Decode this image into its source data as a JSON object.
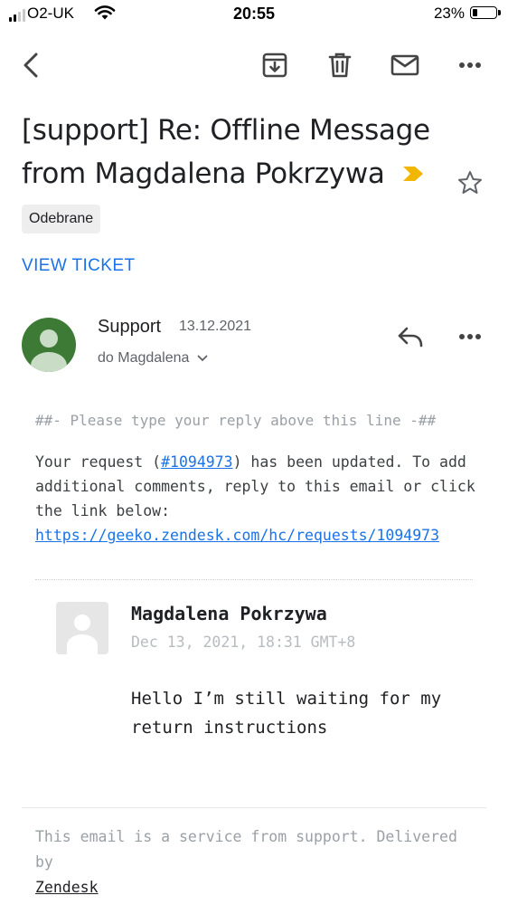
{
  "status_bar": {
    "carrier": "O2-UK",
    "time": "20:55",
    "battery_percent": "23%",
    "battery_level": 0.23
  },
  "toolbar": {
    "back_icon": "chevron-left-icon",
    "archive_icon": "archive-icon",
    "delete_icon": "trash-icon",
    "mark_unread_icon": "mail-icon",
    "more_icon": "more-horizontal-icon"
  },
  "email": {
    "subject_line1": "[support] Re: Offline Message",
    "subject_line2": "from Magdalena Pokrzywa",
    "label": "Odebrane",
    "view_ticket": "VIEW TICKET",
    "sender": {
      "name": "Support",
      "date": "13.12.2021",
      "recipient": "do Magdalena"
    },
    "reply_line": "##- Please type your reply above this line -##",
    "body": {
      "prefix": "Your request (",
      "request_link": "#1094973",
      "suffix": ") has been updated. To add additional comments, reply to this email or click the link below:",
      "url": "https://geeko.zendesk.com/hc/requests/1094973"
    },
    "comment": {
      "author": "Magdalena Pokrzywa",
      "timestamp": "Dec 13, 2021, 18:31 GMT+8",
      "text": "Hello I’m still waiting for my return instructions"
    },
    "footer": {
      "text": "This email is a service from support. Delivered by",
      "link": "Zendesk"
    }
  },
  "colors": {
    "accent": "#1a73e8",
    "importance_marker": "#f2b600",
    "avatar": "#3d7a35"
  }
}
